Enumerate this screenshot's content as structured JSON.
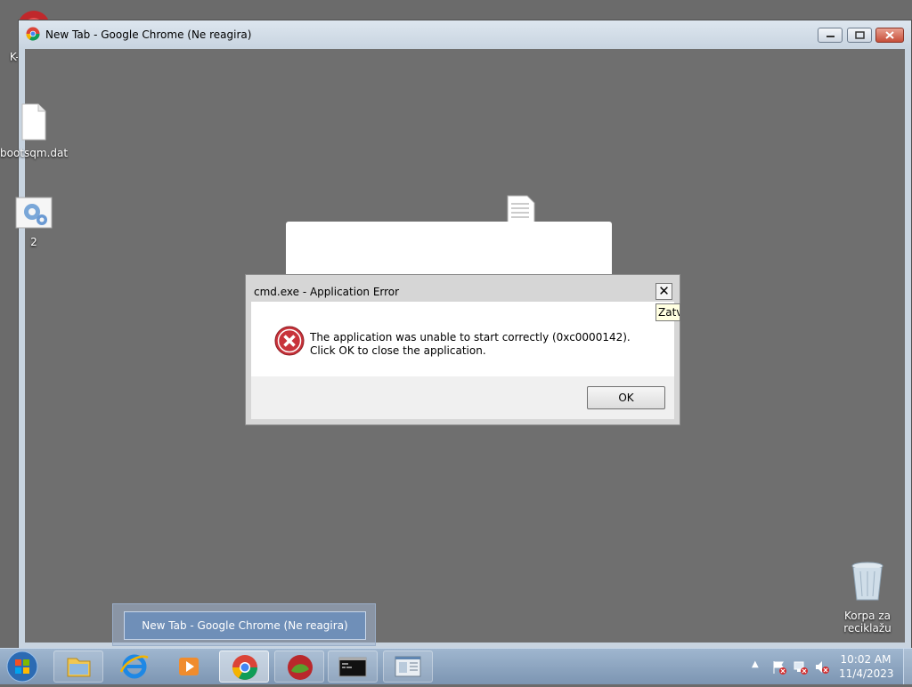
{
  "desktop": {
    "icons": [
      {
        "label": "K-Meleon"
      },
      {
        "label": "bootsqm.dat"
      },
      {
        "label": "2"
      },
      {
        "label": "Korpa za\nreciklažu"
      }
    ]
  },
  "window": {
    "title": "New Tab - Google Chrome (Ne reagira)"
  },
  "dialog": {
    "title": "cmd.exe - Application Error",
    "message": "The application was unable to start correctly (0xc0000142). Click OK to close the application.",
    "ok_label": "OK",
    "close_tooltip": "Zatvori"
  },
  "taskbar": {
    "preview_label": "New Tab - Google Chrome (Ne reagira)",
    "clock_time": "10:02 AM",
    "clock_date": "11/4/2023"
  }
}
